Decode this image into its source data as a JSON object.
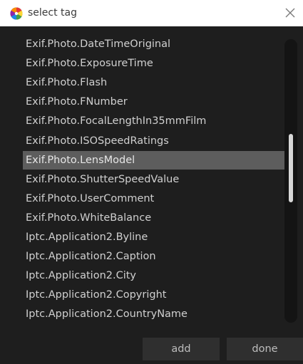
{
  "window": {
    "title": "select tag",
    "app_icon": "colorwheel-app-icon",
    "close_icon": "close-icon"
  },
  "tag_list": {
    "items": [
      "Exif.Photo.DateTimeOriginal",
      "Exif.Photo.ExposureTime",
      "Exif.Photo.Flash",
      "Exif.Photo.FNumber",
      "Exif.Photo.FocalLengthIn35mmFilm",
      "Exif.Photo.ISOSpeedRatings",
      "Exif.Photo.LensModel",
      "Exif.Photo.ShutterSpeedValue",
      "Exif.Photo.UserComment",
      "Exif.Photo.WhiteBalance",
      "Iptc.Application2.Byline",
      "Iptc.Application2.Caption",
      "Iptc.Application2.City",
      "Iptc.Application2.Copyright",
      "Iptc.Application2.CountryName"
    ],
    "selected": "Exif.Photo.LensModel",
    "scroll_position": 0.44,
    "visible_fraction": 0.24
  },
  "buttons": {
    "add_label": "add",
    "done_label": "done"
  },
  "colors": {
    "background": "#1e1e1e",
    "selection": "#5d5d5d",
    "text": "#d0d0d0",
    "button_bg": "#2f2f2f"
  }
}
